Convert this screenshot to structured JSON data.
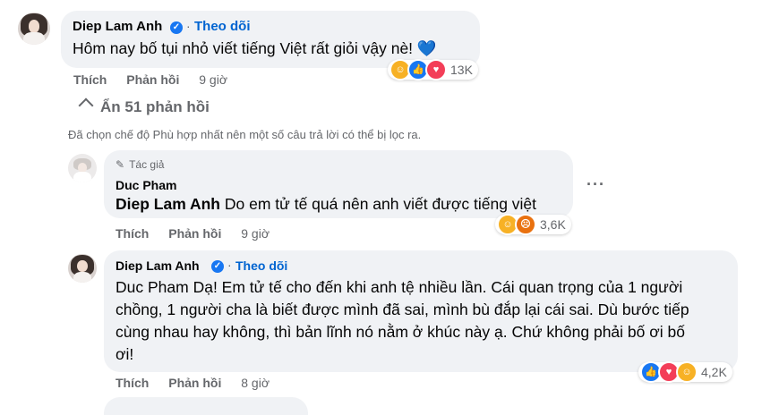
{
  "comments": [
    {
      "author": "Diep Lam Anh",
      "follow": "Theo dõi",
      "text": "Hôm nay bố tụi nhỏ viết tiếng Việt rất giỏi vậy nè!",
      "emoji": "💙",
      "actions": {
        "like": "Thích",
        "reply": "Phản hồi",
        "time": "9 giờ"
      },
      "reactions": {
        "icons": [
          "haha-icon",
          "like-icon",
          "love-icon"
        ],
        "count": "13K"
      }
    }
  ],
  "hide_replies": "Ẩn 51 phản hồi",
  "filter_notice": "Đã chọn chế độ Phù hợp nhất nên một số câu trả lời có thể bị lọc ra.",
  "replies": [
    {
      "author_tag": "Tác giả",
      "author": "Duc Pham",
      "mention": "Diep Lam Anh",
      "text": "Do em tử tế quá nên anh viết được tiếng việt",
      "actions": {
        "like": "Thích",
        "reply": "Phản hồi",
        "time": "9 giờ"
      },
      "reactions": {
        "icons": [
          "haha-icon",
          "angry-icon"
        ],
        "count": "3,6K"
      }
    },
    {
      "author": "Diep Lam Anh",
      "follow": "Theo dõi",
      "mention": "Duc Pham",
      "text_lines": [
        "Dạ! Em tử tế cho đến khi anh tệ nhiều lần. Cái quan trọng của 1 người",
        "chồng, 1 người cha là biết được mình đã sai, mình bù đắp lại cái sai. Dù bước tiếp",
        "cùng nhau hay không, thì bản lĩnh nó nằm ở khúc này ạ. Chứ không phải bố ơi bố",
        "ơi!"
      ],
      "actions": {
        "like": "Thích",
        "reply": "Phản hồi",
        "time": "8 giờ"
      },
      "reactions": {
        "icons": [
          "like-icon",
          "love-icon",
          "care-icon"
        ],
        "count": "4,2K"
      }
    }
  ]
}
